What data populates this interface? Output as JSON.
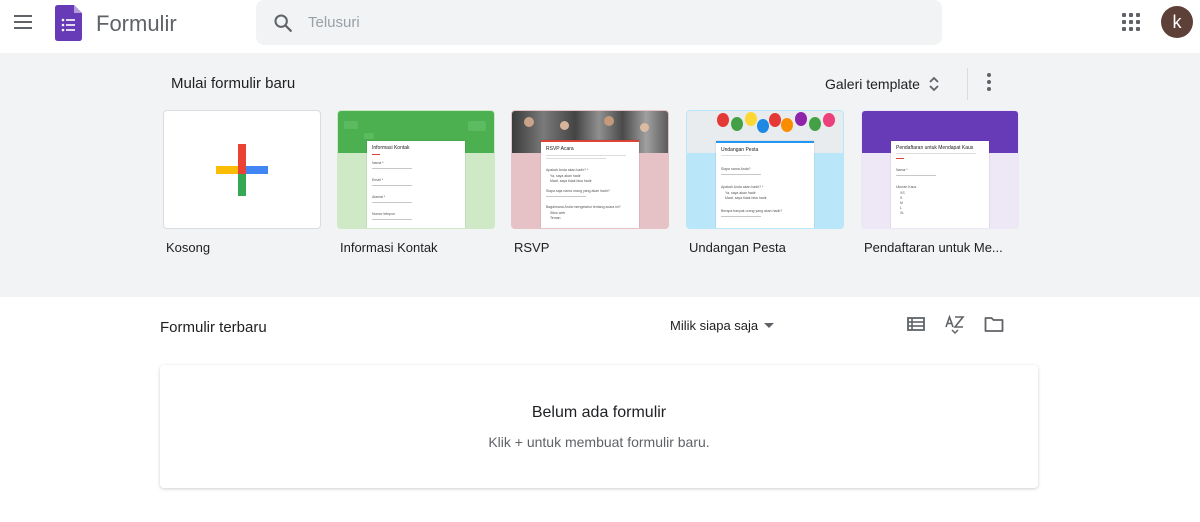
{
  "header": {
    "app_title": "Formulir",
    "search_placeholder": "Telusuri",
    "avatar_initial": "k",
    "icons": [
      "menu-icon",
      "forms-logo-icon",
      "search-icon",
      "apps-grid-icon"
    ]
  },
  "templates_section": {
    "title": "Mulai formulir baru",
    "gallery_label": "Galeri template",
    "templates": [
      {
        "label": "Kosong",
        "theme": "#ffffff"
      },
      {
        "label": "Informasi Kontak",
        "theme": "#4caf50",
        "form_title": "Informasi Kontak",
        "fields": [
          "Nama *",
          "Email *",
          "Alamat *",
          "Nomor telepon"
        ]
      },
      {
        "label": "RSVP",
        "theme": "#db4437",
        "form_title": "RSVP Acara",
        "fields": [
          "Apakah Anda akan hadir? *",
          "Ya, saya akan hadir",
          "Maaf, saya tidak bisa hadir",
          "Siapa saja nama orang yang akan hadir?",
          "Bagaimana Anda mengetahui tentang acara ini?",
          "Situs web",
          "Teman"
        ]
      },
      {
        "label": "Undangan Pesta",
        "theme": "#2196f3",
        "form_title": "Undangan Pesta",
        "fields": [
          "Siapa nama Anda?",
          "Apakah Anda akan hadir? *",
          "Ya, saya akan hadir",
          "Maaf, saya tidak bisa hadir",
          "Berapa banyak orang yang akan hadir?"
        ]
      },
      {
        "label": "Pendaftaran untuk Me...",
        "theme": "#673ab7",
        "form_title": "Pendaftaran untuk Mendapat Kaus",
        "fields": [
          "Nama *",
          "Ukuran Kaus",
          "XS",
          "S",
          "M",
          "L",
          "XL"
        ]
      }
    ]
  },
  "recent_section": {
    "title": "Formulir terbaru",
    "owner_filter": "Milik siapa saja",
    "icons": [
      "list-view-icon",
      "sort-az-icon",
      "folder-icon"
    ],
    "empty_title": "Belum ada formulir",
    "empty_subtitle": "Klik + untuk membuat formulir baru."
  },
  "colors": {
    "brand": "#673ab7",
    "header_bg": "#ffffff",
    "section_bg": "#f1f3f4",
    "avatar_bg": "#5d4037"
  }
}
